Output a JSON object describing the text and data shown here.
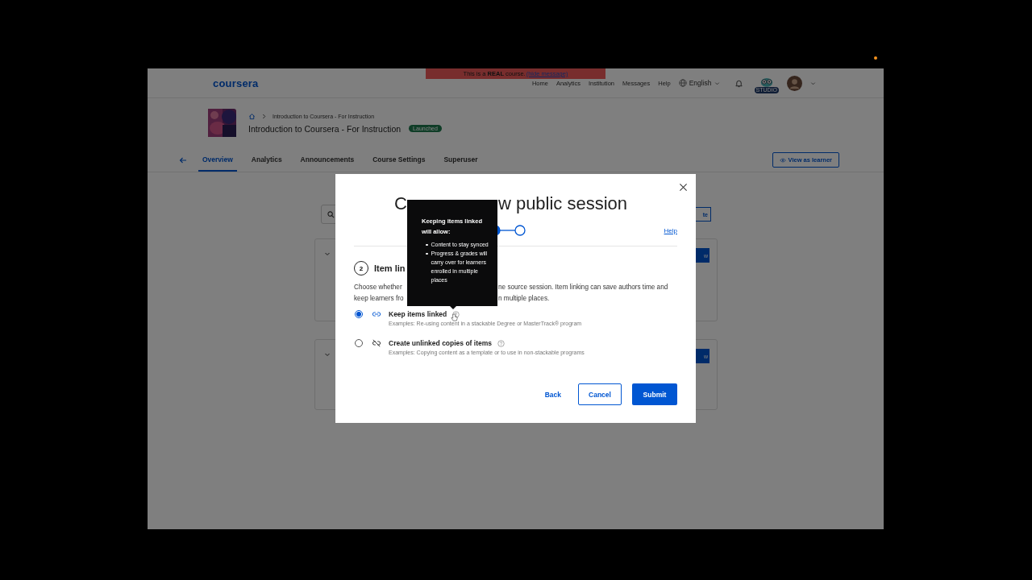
{
  "banner": {
    "text": "This is a **REAL** course.",
    "link": "(hide message)"
  },
  "header": {
    "logo": "coursera",
    "nav": [
      "Home",
      "Analytics",
      "Institution",
      "Messages",
      "Help"
    ],
    "language": "English",
    "studio_badge": "STUDIO"
  },
  "course": {
    "breadcrumb": "Introduction to Coursera - For Instruction",
    "title": "Introduction to Coursera - For Instruction",
    "status": "Launched"
  },
  "tabs": [
    {
      "label": "Overview",
      "selected": true
    },
    {
      "label": "Analytics",
      "selected": false
    },
    {
      "label": "Announcements",
      "selected": false
    },
    {
      "label": "Course Settings",
      "selected": false
    },
    {
      "label": "Superuser",
      "selected": false
    }
  ],
  "view_as_learner": "View as learner",
  "background": {
    "search_button": "te",
    "card_buttons": [
      "w",
      "w"
    ]
  },
  "modal": {
    "title_start": "C",
    "title_end": "w public session",
    "steps": [
      {
        "done": true
      },
      {
        "done": false
      }
    ],
    "help": "Help",
    "step_number": "2",
    "heading": "Item lin",
    "description_lines": [
      {
        "start": "Choose whether",
        "end": "ne source session. Item linking can save authors time and"
      },
      {
        "start": "keep learners fro",
        "end": "n multiple places."
      }
    ],
    "options": [
      {
        "kind": "linked",
        "label": "Keep items linked",
        "example": "Examples: Re-using content in a stackable Degree or MasterTrack® program",
        "selected": true
      },
      {
        "kind": "unlinked",
        "label": "Create unlinked copies of items",
        "example": "Examples: Copying content as a template or to use in non-stackable programs",
        "selected": false
      }
    ],
    "buttons": {
      "back": "Back",
      "cancel": "Cancel",
      "submit": "Submit"
    }
  },
  "tooltip": {
    "title": "Keeping items linked will allow:",
    "items": [
      "Content to stay synced",
      "Progress & grades will carry over for learners enrolled in multiple places"
    ]
  }
}
